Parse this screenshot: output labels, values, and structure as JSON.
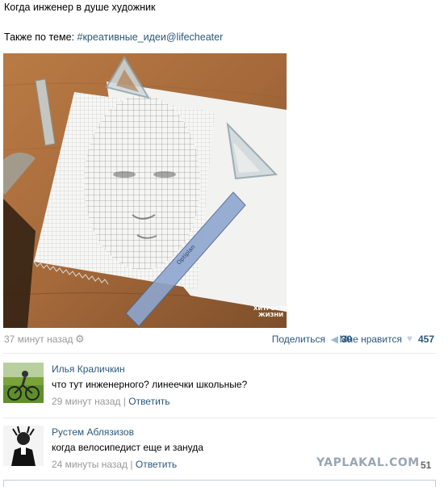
{
  "post": {
    "text": "Когда инженер в душе художник",
    "topic_prefix": "Также по теме: ",
    "topic_link": "#креативные_идеи@lifecheater",
    "photo_watermark_line1": "ХИТРОСТИ",
    "photo_watermark_line2": "ЖИЗНИ",
    "photo_ruler_text": "Optiplan"
  },
  "meta": {
    "time": "37 минут назад",
    "share_label": "Поделиться",
    "share_count": "30",
    "like_label": "Мне нравится",
    "like_count": "457"
  },
  "comments": [
    {
      "author": "Илья Краличкин",
      "text": "что тут инженерного? линеечки школьные?",
      "time": "29 минут назад",
      "separator": "|",
      "reply": "Ответить"
    },
    {
      "author": "Рустем Аблязизов",
      "text": "когда велосипедист еще и зануда",
      "time": "24 минуты назад",
      "separator": "|",
      "reply": "Ответить"
    }
  ],
  "watermark": {
    "text": "YAPLAKAL.COM",
    "number": "51"
  },
  "colors": {
    "link": "#2b587a",
    "muted": "#999999",
    "divider": "#e7eaed"
  }
}
